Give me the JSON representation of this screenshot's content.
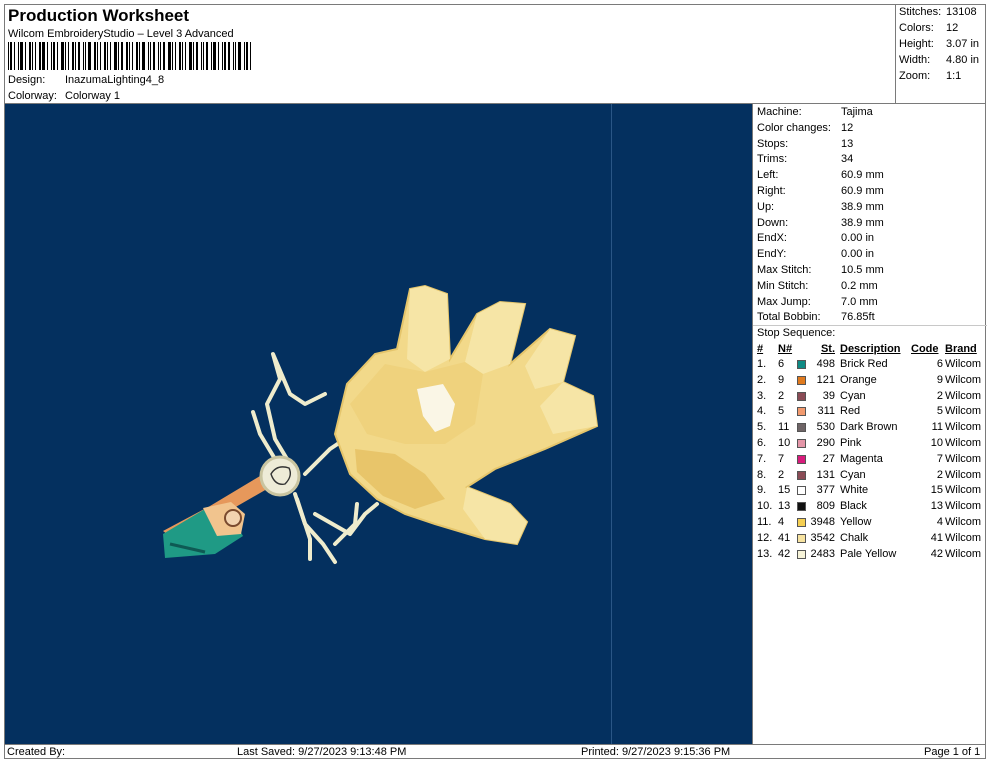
{
  "header": {
    "title": "Production Worksheet",
    "subtitle": "Wilcom EmbroideryStudio – Level 3 Advanced",
    "design_label": "Design:",
    "design_value": "InazumaLighting4_8",
    "colorway_label": "Colorway:",
    "colorway_value": "Colorway 1"
  },
  "stats": {
    "stitches_label": "Stitches:",
    "stitches": "13108",
    "colors_label": "Colors:",
    "colors": "12",
    "height_label": "Height:",
    "height": "3.07 in",
    "width_label": "Width:",
    "width": "4.80 in",
    "zoom_label": "Zoom:",
    "zoom": "1:1"
  },
  "machine": [
    {
      "label": "Machine:",
      "value": "Tajima"
    },
    {
      "label": "Color changes:",
      "value": "12"
    },
    {
      "label": "Stops:",
      "value": "13"
    },
    {
      "label": "Trims:",
      "value": "34"
    },
    {
      "label": "Left:",
      "value": "60.9 mm"
    },
    {
      "label": "Right:",
      "value": "60.9 mm"
    },
    {
      "label": "Up:",
      "value": "38.9 mm"
    },
    {
      "label": "Down:",
      "value": "38.9 mm"
    },
    {
      "label": "EndX:",
      "value": "0.00 in"
    },
    {
      "label": "EndY:",
      "value": "0.00 in"
    },
    {
      "label": "Max Stitch:",
      "value": "10.5 mm"
    },
    {
      "label": "Min Stitch:",
      "value": "0.2 mm"
    },
    {
      "label": "Max Jump:",
      "value": "7.0 mm"
    },
    {
      "label": "Total Bobbin:",
      "value": "76.85ft"
    }
  ],
  "stop_sequence": {
    "title": "Stop Sequence:",
    "headers": {
      "num": "#",
      "n": "N#",
      "st": "St.",
      "desc": "Description",
      "code": "Code",
      "brand": "Brand"
    },
    "rows": [
      {
        "num": "1.",
        "n": "6",
        "color": "#0e8a84",
        "st": "498",
        "desc": "Brick Red",
        "code": "6",
        "brand": "Wilcom"
      },
      {
        "num": "2.",
        "n": "9",
        "color": "#e07a1e",
        "st": "121",
        "desc": "Orange",
        "code": "9",
        "brand": "Wilcom"
      },
      {
        "num": "3.",
        "n": "2",
        "color": "#8a4b55",
        "st": "39",
        "desc": "Cyan",
        "code": "2",
        "brand": "Wilcom"
      },
      {
        "num": "4.",
        "n": "5",
        "color": "#f29a6e",
        "st": "311",
        "desc": "Red",
        "code": "5",
        "brand": "Wilcom"
      },
      {
        "num": "5.",
        "n": "11",
        "color": "#6e6466",
        "st": "530",
        "desc": "Dark Brown",
        "code": "11",
        "brand": "Wilcom"
      },
      {
        "num": "6.",
        "n": "10",
        "color": "#e496a8",
        "st": "290",
        "desc": "Pink",
        "code": "10",
        "brand": "Wilcom"
      },
      {
        "num": "7.",
        "n": "7",
        "color": "#d81b7c",
        "st": "27",
        "desc": "Magenta",
        "code": "7",
        "brand": "Wilcom"
      },
      {
        "num": "8.",
        "n": "2",
        "color": "#8a4b55",
        "st": "131",
        "desc": "Cyan",
        "code": "2",
        "brand": "Wilcom"
      },
      {
        "num": "9.",
        "n": "15",
        "color": "#ffffff",
        "st": "377",
        "desc": "White",
        "code": "15",
        "brand": "Wilcom"
      },
      {
        "num": "10.",
        "n": "13",
        "color": "#111111",
        "st": "809",
        "desc": "Black",
        "code": "13",
        "brand": "Wilcom"
      },
      {
        "num": "11.",
        "n": "4",
        "color": "#f5cf52",
        "st": "3948",
        "desc": "Yellow",
        "code": "4",
        "brand": "Wilcom"
      },
      {
        "num": "12.",
        "n": "41",
        "color": "#f7e3a0",
        "st": "3542",
        "desc": "Chalk",
        "code": "41",
        "brand": "Wilcom"
      },
      {
        "num": "13.",
        "n": "42",
        "color": "#f6f3d8",
        "st": "2483",
        "desc": "Pale Yellow",
        "code": "42",
        "brand": "Wilcom"
      }
    ]
  },
  "footer": {
    "created": "Created By:",
    "saved": "Last Saved: 9/27/2023 9:13:48 PM",
    "printed": "Printed: 9/27/2023 9:15:36 PM",
    "page": "Page 1 of 1"
  },
  "colors": {
    "canvas": "#04305f",
    "hand": "#f2d98a",
    "lightning": "#efeccd"
  }
}
